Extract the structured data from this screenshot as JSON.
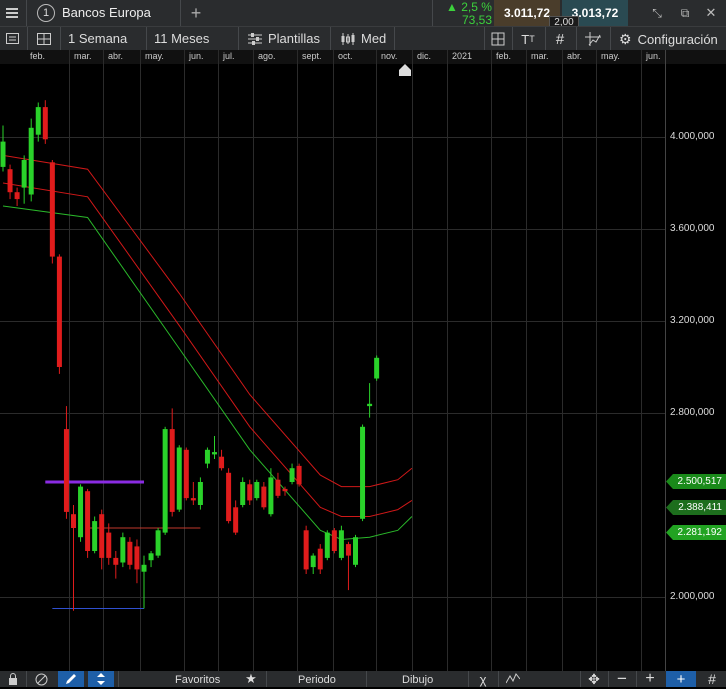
{
  "titlebar": {
    "menu_icon": "hamburger-icon",
    "window_number": "1",
    "instrument": "Bancos Europa",
    "add_icon": "plus-icon",
    "change_pct": "2,5 %",
    "change_abs": "73,53",
    "bid": "3.011,72",
    "ask": "3.013,72",
    "spread": "2,00",
    "colors": {
      "bid_bg": "#4a3d2b",
      "ask_bg": "#2a4a52",
      "up": "#3cd23c"
    }
  },
  "toolbar": {
    "interval": "1 Semana",
    "range": "11 Meses",
    "templates": "Plantillas",
    "price_type": "Med",
    "settings": "Configuración"
  },
  "months": [
    "feb.",
    "mar.",
    "abr.",
    "may.",
    "jun.",
    "jul.",
    "ago.",
    "sept.",
    "oct.",
    "nov.",
    "dic.",
    "2021",
    "feb.",
    "mar.",
    "abr.",
    "may.",
    "jun."
  ],
  "axis": {
    "labels": [
      "4.000,000",
      "3.600,000",
      "3.200,000",
      "2.800,000",
      "2.000,000"
    ],
    "tags": [
      {
        "value": "2.500,517",
        "color": "#1a8a1a"
      },
      {
        "value": "2.388,411",
        "color": "#1d6e1d"
      },
      {
        "value": "2.281,192",
        "color": "#22a322"
      }
    ]
  },
  "bottombar": {
    "favorites": "Favoritos",
    "period": "Periodo",
    "drawing": "Dibujo"
  },
  "chart_data": {
    "type": "candlestick",
    "instrument": "Bancos Europa",
    "interval": "1 Semana",
    "y_range": [
      1900,
      4300
    ],
    "y_ticks": [
      4000,
      3600,
      3200,
      2800,
      2000
    ],
    "candles": [
      {
        "o": 3870,
        "c": 3980,
        "h": 4050,
        "l": 3850
      },
      {
        "o": 3860,
        "c": 3760,
        "h": 3880,
        "l": 3730
      },
      {
        "o": 3760,
        "c": 3730,
        "h": 3780,
        "l": 3700
      },
      {
        "o": 3780,
        "c": 3900,
        "h": 3920,
        "l": 3710
      },
      {
        "o": 3750,
        "c": 4040,
        "h": 4080,
        "l": 3720
      },
      {
        "o": 4010,
        "c": 4130,
        "h": 4150,
        "l": 3980
      },
      {
        "o": 4130,
        "c": 3990,
        "h": 4160,
        "l": 3970
      },
      {
        "o": 3890,
        "c": 3480,
        "h": 3900,
        "l": 3450
      },
      {
        "o": 3480,
        "c": 3000,
        "h": 3490,
        "l": 2970
      },
      {
        "o": 2730,
        "c": 2370,
        "h": 2830,
        "l": 2340
      },
      {
        "o": 2360,
        "c": 2300,
        "h": 2400,
        "l": 1940
      },
      {
        "o": 2260,
        "c": 2480,
        "h": 2490,
        "l": 2240
      },
      {
        "o": 2460,
        "c": 2200,
        "h": 2470,
        "l": 2170
      },
      {
        "o": 2200,
        "c": 2330,
        "h": 2350,
        "l": 2190
      },
      {
        "o": 2360,
        "c": 2170,
        "h": 2380,
        "l": 2120
      },
      {
        "o": 2280,
        "c": 2170,
        "h": 2320,
        "l": 2140
      },
      {
        "o": 2170,
        "c": 2140,
        "h": 2200,
        "l": 2080
      },
      {
        "o": 2150,
        "c": 2260,
        "h": 2280,
        "l": 2130
      },
      {
        "o": 2240,
        "c": 2140,
        "h": 2260,
        "l": 2120
      },
      {
        "o": 2220,
        "c": 2120,
        "h": 2250,
        "l": 2060
      },
      {
        "o": 2110,
        "c": 2140,
        "h": 2180,
        "l": 1950
      },
      {
        "o": 2160,
        "c": 2190,
        "h": 2200,
        "l": 2130
      },
      {
        "o": 2180,
        "c": 2290,
        "h": 2300,
        "l": 2170
      },
      {
        "o": 2280,
        "c": 2730,
        "h": 2740,
        "l": 2270
      },
      {
        "o": 2730,
        "c": 2370,
        "h": 2820,
        "l": 2350
      },
      {
        "o": 2380,
        "c": 2650,
        "h": 2660,
        "l": 2370
      },
      {
        "o": 2640,
        "c": 2430,
        "h": 2650,
        "l": 2420
      },
      {
        "o": 2430,
        "c": 2420,
        "h": 2500,
        "l": 2400
      },
      {
        "o": 2400,
        "c": 2500,
        "h": 2520,
        "l": 2380
      },
      {
        "o": 2580,
        "c": 2640,
        "h": 2650,
        "l": 2560
      },
      {
        "o": 2620,
        "c": 2630,
        "h": 2700,
        "l": 2600
      },
      {
        "o": 2610,
        "c": 2560,
        "h": 2640,
        "l": 2550
      },
      {
        "o": 2540,
        "c": 2330,
        "h": 2560,
        "l": 2320
      },
      {
        "o": 2390,
        "c": 2280,
        "h": 2420,
        "l": 2270
      },
      {
        "o": 2400,
        "c": 2500,
        "h": 2520,
        "l": 2390
      },
      {
        "o": 2490,
        "c": 2420,
        "h": 2510,
        "l": 2400
      },
      {
        "o": 2430,
        "c": 2500,
        "h": 2510,
        "l": 2420
      },
      {
        "o": 2480,
        "c": 2390,
        "h": 2500,
        "l": 2380
      },
      {
        "o": 2360,
        "c": 2520,
        "h": 2560,
        "l": 2350
      },
      {
        "o": 2510,
        "c": 2440,
        "h": 2540,
        "l": 2430
      },
      {
        "o": 2470,
        "c": 2460,
        "h": 2480,
        "l": 2440
      },
      {
        "o": 2500,
        "c": 2560,
        "h": 2580,
        "l": 2490
      },
      {
        "o": 2570,
        "c": 2490,
        "h": 2580,
        "l": 2480
      },
      {
        "o": 2290,
        "c": 2120,
        "h": 2310,
        "l": 2100
      },
      {
        "o": 2130,
        "c": 2180,
        "h": 2190,
        "l": 2100
      },
      {
        "o": 2210,
        "c": 2120,
        "h": 2230,
        "l": 2100
      },
      {
        "o": 2170,
        "c": 2280,
        "h": 2290,
        "l": 2160
      },
      {
        "o": 2290,
        "c": 2200,
        "h": 2300,
        "l": 2190
      },
      {
        "o": 2170,
        "c": 2290,
        "h": 2310,
        "l": 2160
      },
      {
        "o": 2230,
        "c": 2180,
        "h": 2240,
        "l": 2030
      },
      {
        "o": 2140,
        "c": 2260,
        "h": 2270,
        "l": 2130
      },
      {
        "o": 2340,
        "c": 2740,
        "h": 2750,
        "l": 2330
      },
      {
        "o": 2830,
        "c": 2840,
        "h": 2930,
        "l": 2780
      },
      {
        "o": 2950,
        "c": 3040,
        "h": 3050,
        "l": 2940
      }
    ],
    "envelope_upper_red": [
      [
        0,
        3920
      ],
      [
        12,
        3860
      ],
      [
        25,
        3320
      ],
      [
        35,
        2880
      ],
      [
        45,
        2530
      ],
      [
        48,
        2480
      ],
      [
        52,
        2480
      ],
      [
        56,
        2510
      ],
      [
        58,
        2560
      ]
    ],
    "envelope_lower_red": [
      [
        0,
        3800
      ],
      [
        12,
        3740
      ],
      [
        25,
        3180
      ],
      [
        35,
        2740
      ],
      [
        45,
        2390
      ],
      [
        48,
        2350
      ],
      [
        52,
        2350
      ],
      [
        56,
        2380
      ],
      [
        58,
        2420
      ]
    ],
    "moving_avg_green": [
      [
        0,
        3700
      ],
      [
        12,
        3650
      ],
      [
        25,
        3080
      ],
      [
        35,
        2640
      ],
      [
        45,
        2290
      ],
      [
        48,
        2250
      ],
      [
        52,
        2260
      ],
      [
        56,
        2290
      ],
      [
        58,
        2350
      ]
    ],
    "horizontal_lines": [
      {
        "y": 2500,
        "x_from": 6,
        "x_to": 20,
        "color": "#8a2be2"
      },
      {
        "y": 2300,
        "x_from": 12,
        "x_to": 28,
        "color": "#c0392b"
      },
      {
        "y": 1950,
        "x_from": 7,
        "x_to": 20,
        "color": "#3050d0"
      }
    ],
    "last_values": [
      2500.517,
      2388.411,
      2281.192
    ]
  }
}
